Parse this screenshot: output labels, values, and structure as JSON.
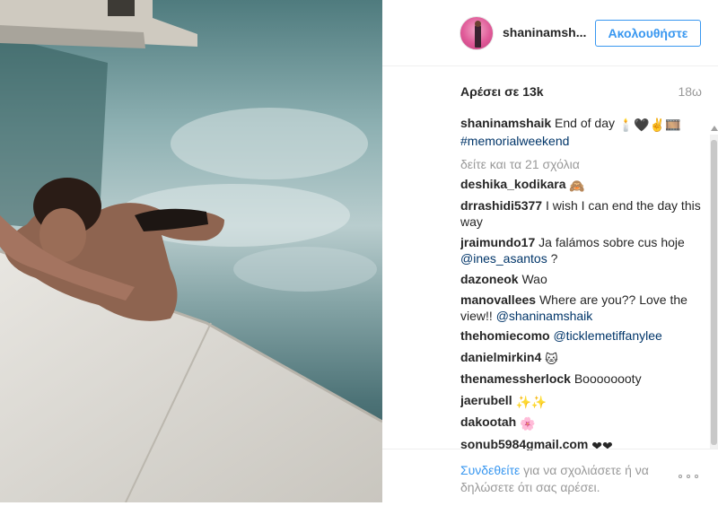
{
  "post": {
    "username": "shaninamsh...",
    "follow_label": "Ακολουθήστε",
    "likes": "Αρέσει σε 13k",
    "age": "18ω",
    "caption": {
      "user": "shaninamshaik",
      "text": "End of day",
      "emojis": "🕯️🖤✌️🎞️",
      "hashtag": "#memorialweekend"
    },
    "view_all_comments": "δείτε και τα 21 σχόλια",
    "comments": [
      {
        "user": "deshika_kodikara",
        "text": "",
        "emoji": "🙈"
      },
      {
        "user": "drrashidi5377",
        "text": "I wish I can end the day this way"
      },
      {
        "user": "jraimundo17",
        "text": "Ja falámos sobre cus hoje",
        "mention": "@ines_asantos",
        "tail": " ?"
      },
      {
        "user": "dazoneok",
        "text": "Wao"
      },
      {
        "user": "manovallees",
        "text": "Where are you?? Love the view!!",
        "mention": "@shaninamshaik"
      },
      {
        "user": "thehomiecomo",
        "text": "",
        "mention": "@ticklemetiffanylee"
      },
      {
        "user": "danielmirkin4",
        "text": "",
        "emoji": "🐱"
      },
      {
        "user": "thenamessherlock",
        "text": "Boooooooty"
      },
      {
        "user": "jaerubell",
        "text": "",
        "emoji": "✨✨"
      },
      {
        "user": "dakootah",
        "text": "",
        "emoji": "🌸"
      },
      {
        "user": "sonub5984gmail.com",
        "text": "",
        "emoji": "❤❤"
      }
    ],
    "footer": {
      "link": "Συνδεθείτε",
      "text": " για να σχολιάσετε ή να δηλώσετε ότι σας αρέσει."
    }
  },
  "icons": {
    "more_options": "ellipsis-icon",
    "avatar": "profile-avatar"
  },
  "colors": {
    "accent": "#3897f0",
    "tag": "#003569",
    "muted": "#999999",
    "text": "#262626"
  }
}
